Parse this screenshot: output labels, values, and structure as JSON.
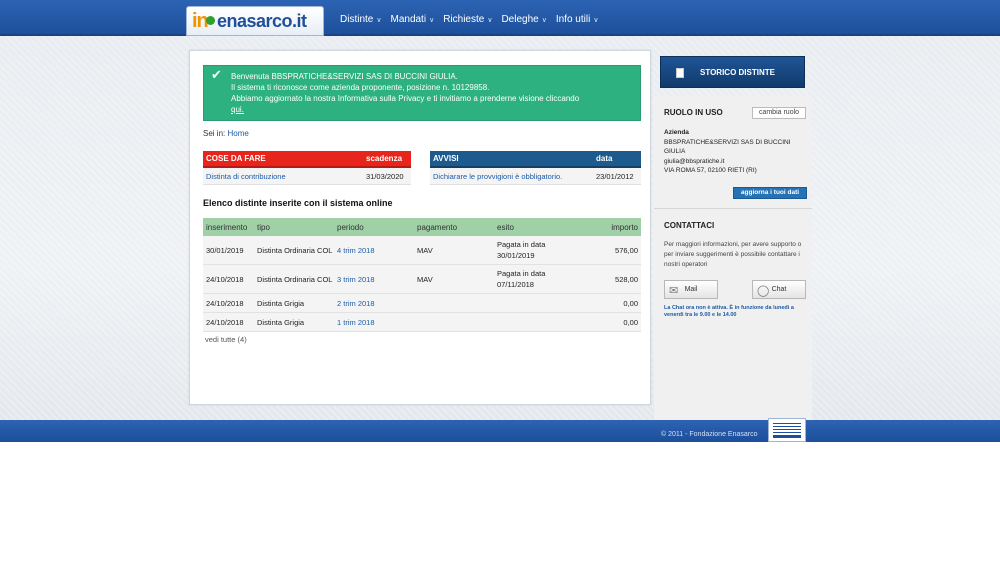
{
  "header": {
    "logo_in": "in",
    "logo_rest": "enasarco.it",
    "nav": [
      {
        "label": "Distinte"
      },
      {
        "label": "Mandati"
      },
      {
        "label": "Richieste"
      },
      {
        "label": "Deleghe"
      },
      {
        "label": "Info utili"
      }
    ]
  },
  "welcome": {
    "line1": "Benvenuta BBSPRATICHE&SERVIZI SAS DI BUCCINI GIULIA.",
    "line2": "Il sistema ti riconosce come azienda proponente, posizione n. 10129858.",
    "line3": "Abbiamo aggiornato la nostra Informativa sulla Privacy e ti invitiamo a prenderne visione cliccando",
    "link": "qui."
  },
  "breadcrumb": {
    "prefix": "Sei in:",
    "home": "Home"
  },
  "cose_da_fare": {
    "title": "COSE DA FARE",
    "col": "scadenza",
    "rows": [
      {
        "label": "Distinta di contribuzione",
        "date": "31/03/2020"
      }
    ]
  },
  "avvisi": {
    "title": "AVVISI",
    "col": "data",
    "rows": [
      {
        "label": "Dichiarare le provvigioni è obbligatorio.",
        "date": "23/01/2012"
      }
    ]
  },
  "distinte": {
    "title": "Elenco distinte inserite con il sistema online",
    "headers": [
      "inserimento",
      "tipo",
      "periodo",
      "pagamento",
      "esito",
      "importo"
    ],
    "rows": [
      {
        "inserimento": "30/01/2019",
        "tipo": "Distinta Ordinaria COL",
        "periodo": "4 trim 2018",
        "pagamento": "MAV",
        "esito": "Pagata in data 30/01/2019",
        "importo": "576,00"
      },
      {
        "inserimento": "24/10/2018",
        "tipo": "Distinta Ordinaria COL",
        "periodo": "3 trim 2018",
        "pagamento": "MAV",
        "esito": "Pagata in data 07/11/2018",
        "importo": "528,00"
      },
      {
        "inserimento": "24/10/2018",
        "tipo": "Distinta Grigia",
        "periodo": "2 trim 2018",
        "pagamento": "",
        "esito": "",
        "importo": "0,00"
      },
      {
        "inserimento": "24/10/2018",
        "tipo": "Distinta Grigia",
        "periodo": "1 trim 2018",
        "pagamento": "",
        "esito": "",
        "importo": "0,00"
      }
    ],
    "vedi_tutte": "vedi tutte (4)"
  },
  "sidebar": {
    "storico": "STORICO DISTINTE",
    "ruolo_title": "RUOLO IN USO",
    "cambia_ruolo": "cambia ruolo",
    "azienda_label": "Azienda",
    "azienda_name": "BBSPRATICHE&SERVIZI SAS DI BUCCINI GIULIA",
    "email": "giulia@bbspratiche.it",
    "address": "VIA ROMA 57, 02100 RIETI (RI)",
    "aggiorna": "aggiorna i tuoi dati",
    "contattaci": "CONTATTACI",
    "info": "Per maggiori informazioni, per avere supporto o per inviare suggerimenti è possibile contattare i nostri operatori",
    "mail": "Mail",
    "chat": "Chat",
    "chat_note": "La Chat ora non è attiva. È in funzione da lunedì a venerdì tra le 9.00 e le 14.00"
  },
  "footer": {
    "copyright": "© 2011 - Fondazione Enasarco"
  }
}
